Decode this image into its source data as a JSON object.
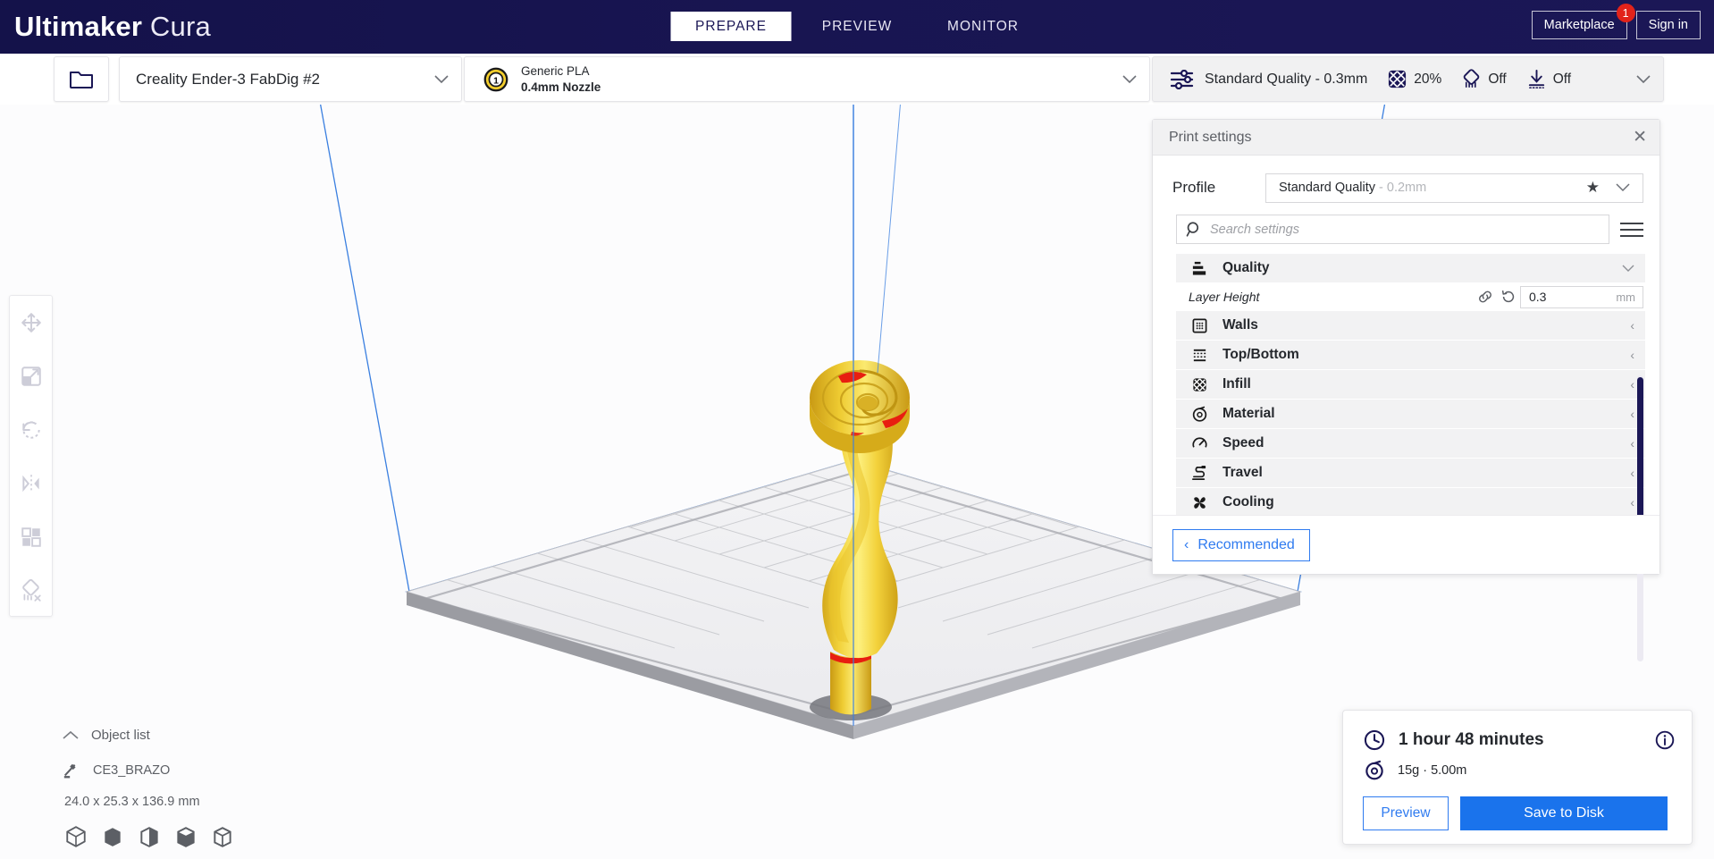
{
  "app": {
    "brand_bold": "Ultimaker",
    "brand_light": "Cura",
    "tabs": [
      {
        "label": "PREPARE",
        "active": true
      },
      {
        "label": "PREVIEW",
        "active": false
      },
      {
        "label": "MONITOR",
        "active": false
      }
    ],
    "marketplace_label": "Marketplace",
    "marketplace_badge": "1",
    "signin_label": "Sign in",
    "accent_blue": "#1a73ec",
    "header_navy": "#1b1756",
    "alert_red": "#e2231a"
  },
  "toolbar": {
    "open_file_icon": "folder-icon",
    "machine": "Creality Ender-3 FabDig #2",
    "material": {
      "extruder_number": "1",
      "name": "Generic PLA",
      "nozzle": "0.4mm Nozzle"
    },
    "quality_summary": "Standard Quality - 0.3mm",
    "chips": [
      {
        "icon": "infill-grid-icon",
        "value": "20%"
      },
      {
        "icon": "support-icon",
        "value": "Off"
      },
      {
        "icon": "adhesion-icon",
        "value": "Off"
      }
    ]
  },
  "tools": [
    {
      "name": "move-tool",
      "icon": "move-icon"
    },
    {
      "name": "scale-tool",
      "icon": "scale-icon"
    },
    {
      "name": "rotate-tool",
      "icon": "rotate-icon"
    },
    {
      "name": "mirror-tool",
      "icon": "mirror-icon"
    },
    {
      "name": "per-model-settings-tool",
      "icon": "per-model-settings-icon"
    },
    {
      "name": "support-blocker-tool",
      "icon": "support-blocker-icon"
    }
  ],
  "print_settings": {
    "title": "Print settings",
    "close_icon": "close-icon",
    "profile_label": "Profile",
    "profile_value": "Standard Quality",
    "profile_suffix": "- 0.2mm",
    "search_placeholder": "Search settings",
    "search_value": "",
    "menu_icon": "hamburger-icon",
    "categories": [
      {
        "label": "Quality",
        "icon": "quality-icon",
        "expanded": true,
        "arrow": "⌄"
      },
      {
        "label": "Walls",
        "icon": "walls-icon",
        "expanded": false,
        "arrow": "‹"
      },
      {
        "label": "Top/Bottom",
        "icon": "topbottom-icon",
        "expanded": false,
        "arrow": "‹"
      },
      {
        "label": "Infill",
        "icon": "infill-icon",
        "expanded": false,
        "arrow": "‹"
      },
      {
        "label": "Material",
        "icon": "material-icon",
        "expanded": false,
        "arrow": "‹"
      },
      {
        "label": "Speed",
        "icon": "speed-icon",
        "expanded": false,
        "arrow": "‹"
      },
      {
        "label": "Travel",
        "icon": "travel-icon",
        "expanded": false,
        "arrow": "‹"
      },
      {
        "label": "Cooling",
        "icon": "cooling-icon",
        "expanded": false,
        "arrow": "‹"
      }
    ],
    "quality_settings": [
      {
        "label": "Layer Height",
        "value": "0.3",
        "unit": "mm",
        "link_icon": "link-icon",
        "revert_icon": "revert-icon"
      }
    ],
    "recommended_label": "Recommended",
    "recommended_arrow": "‹"
  },
  "object_list": {
    "title": "Object list",
    "collapse_arrow": "⌃",
    "item_name": "CE3_BRAZO",
    "item_icon": "mesh-type-icon",
    "dimensions": "24.0 x 25.3 x 136.9 mm",
    "view_icons": [
      "solid-view-icon",
      "xray-view-icon",
      "layer-view-icon",
      "shell-view-icon",
      "wireframe-view-icon"
    ]
  },
  "job": {
    "time_icon": "clock-icon",
    "time": "1 hour 48 minutes",
    "info_icon": "info-icon",
    "material_icon": "spool-icon",
    "material_usage": "15g · 5.00m",
    "preview_label": "Preview",
    "save_label": "Save to Disk"
  },
  "viewport": {
    "model_name": "CE3_BRAZO",
    "model_color": "#f5d932",
    "overhang_color": "#e81e10",
    "buildplate_color": "#e9e9ec"
  }
}
